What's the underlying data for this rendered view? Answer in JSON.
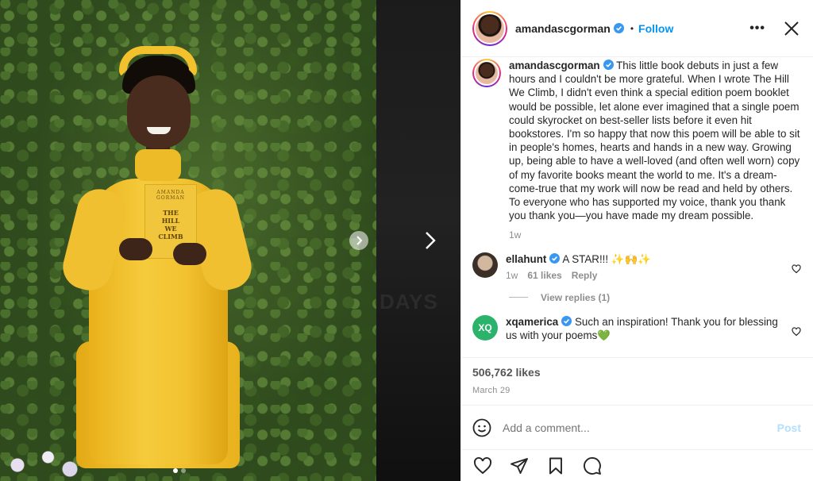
{
  "media": {
    "book": {
      "author": "AMANDA GORMAN",
      "title": "THE HILL WE CLIMB"
    },
    "background_text": "DAYS",
    "carousel": {
      "count": 2,
      "active_index": 0
    }
  },
  "header": {
    "username": "amandascgorman",
    "separator": "•",
    "follow_label": "Follow",
    "more_label": "•••"
  },
  "caption": {
    "username": "amandascgorman",
    "text": "This little book debuts in just a few hours and I couldn't be more grateful. When I wrote The Hill We Climb, I didn't even think a special edition poem booklet would be possible, let alone ever imagined that a single poem could skyrocket on best-seller lists before it even hit bookstores. I'm so happy that now this poem will be able to sit in people's homes, hearts and hands in a new way. Growing up, being able to have a well-loved (and often well worn) copy of my favorite books meant the world to me. It's a dream-come-true that my work will now be read and held by others. To everyone who has supported my voice, thank you thank you thank you—you have made my dream possible.",
    "time": "1w"
  },
  "comments": [
    {
      "username": "ellahunt",
      "text": "A STAR!!! ✨🙌✨",
      "time": "1w",
      "likes": "61 likes",
      "reply_label": "Reply",
      "view_replies": "View replies (1)"
    },
    {
      "username": "xqamerica",
      "avatar_text": "XQ",
      "text": "Such an inspiration! Thank you for blessing us with your poems💚"
    }
  ],
  "post_meta": {
    "likes": "506,762 likes",
    "date": "March 29"
  },
  "add_comment": {
    "placeholder": "Add a comment...",
    "post_label": "Post"
  },
  "colors": {
    "link_blue": "#0095f6",
    "post_disabled": "#b2dffc",
    "verified": "#3897f0",
    "dress_yellow": "#f2c230"
  },
  "icons": [
    "verified-badge-icon",
    "close-icon",
    "more-icon",
    "chevron-right-icon",
    "heart-icon",
    "comment-icon",
    "share-icon",
    "bookmark-icon",
    "emoji-icon"
  ]
}
